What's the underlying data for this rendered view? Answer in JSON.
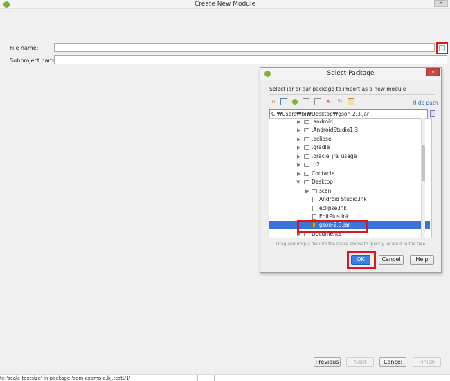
{
  "window": {
    "title": "Create New Module",
    "close_glyph": "✕",
    "fields": [
      {
        "label": "File name:",
        "value": ""
      },
      {
        "label": "Subproject name:",
        "value": ""
      }
    ],
    "browse_glyph": "…",
    "buttons": {
      "previous": "Previous",
      "next": "Next",
      "cancel": "Cancel",
      "finish": "Finish"
    },
    "status_text": "te 'scale textsize' in package 'com.example.bj.testU1'"
  },
  "dialog": {
    "title": "Select Package",
    "close_glyph": "✕",
    "description": "Select jar or aar package to import as a new module",
    "hide_path": "Hide path",
    "path": "C:₩Users₩bj₩Desktop₩gson-2.3.jar",
    "tree": [
      {
        "label": ".android",
        "depth": 0,
        "type": "folder",
        "expanded": false
      },
      {
        "label": ".AndroidStudio1.3",
        "depth": 0,
        "type": "folder",
        "expanded": false
      },
      {
        "label": ".eclipse",
        "depth": 0,
        "type": "folder",
        "expanded": false
      },
      {
        "label": ".gradle",
        "depth": 0,
        "type": "folder",
        "expanded": false
      },
      {
        "label": ".oracle_jre_usage",
        "depth": 0,
        "type": "folder",
        "expanded": false
      },
      {
        "label": ".p2",
        "depth": 0,
        "type": "folder",
        "expanded": false
      },
      {
        "label": "Contacts",
        "depth": 0,
        "type": "folder",
        "expanded": false
      },
      {
        "label": "Desktop",
        "depth": 0,
        "type": "folder",
        "expanded": true
      },
      {
        "label": "scan",
        "depth": 1,
        "type": "folder",
        "expanded": false
      },
      {
        "label": "Android Studio.lnk",
        "depth": 1,
        "type": "file"
      },
      {
        "label": "eclipse.lnk",
        "depth": 1,
        "type": "file"
      },
      {
        "label": "EditPlus.lnk",
        "depth": 1,
        "type": "file"
      },
      {
        "label": "gson-2.3.jar",
        "depth": 1,
        "type": "jar",
        "selected": true
      },
      {
        "label": "Documents",
        "depth": 0,
        "type": "folder",
        "expanded": false
      }
    ],
    "hint": "Drag and drop a file into the space above to quickly locate it in the tree.",
    "buttons": {
      "ok": "OK",
      "cancel": "Cancel",
      "help": "Help"
    }
  },
  "colors": {
    "highlight": "#e0141c",
    "selection": "#3875d7",
    "link": "#3a6fb7"
  }
}
